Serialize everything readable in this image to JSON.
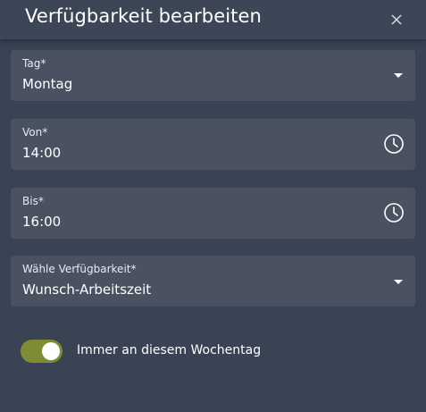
{
  "dialog": {
    "title": "Verfügbarkeit bearbeiten"
  },
  "fields": {
    "tag": {
      "label": "Tag*",
      "value": "Montag",
      "icon": "caret-down-icon"
    },
    "von": {
      "label": "Von*",
      "value": "14:00",
      "icon": "clock-icon"
    },
    "bis": {
      "label": "Bis*",
      "value": "16:00",
      "icon": "clock-icon"
    },
    "availability": {
      "label": "Wähle Verfügbarkeit*",
      "value": "Wunsch-Arbeitszeit",
      "icon": "caret-down-icon"
    }
  },
  "toggle": {
    "label": "Immer an diesem Wochentag",
    "checked": true
  },
  "colors": {
    "background": "#3a4353",
    "field": "#4a5262",
    "toggle_on": "#7f8c34"
  }
}
